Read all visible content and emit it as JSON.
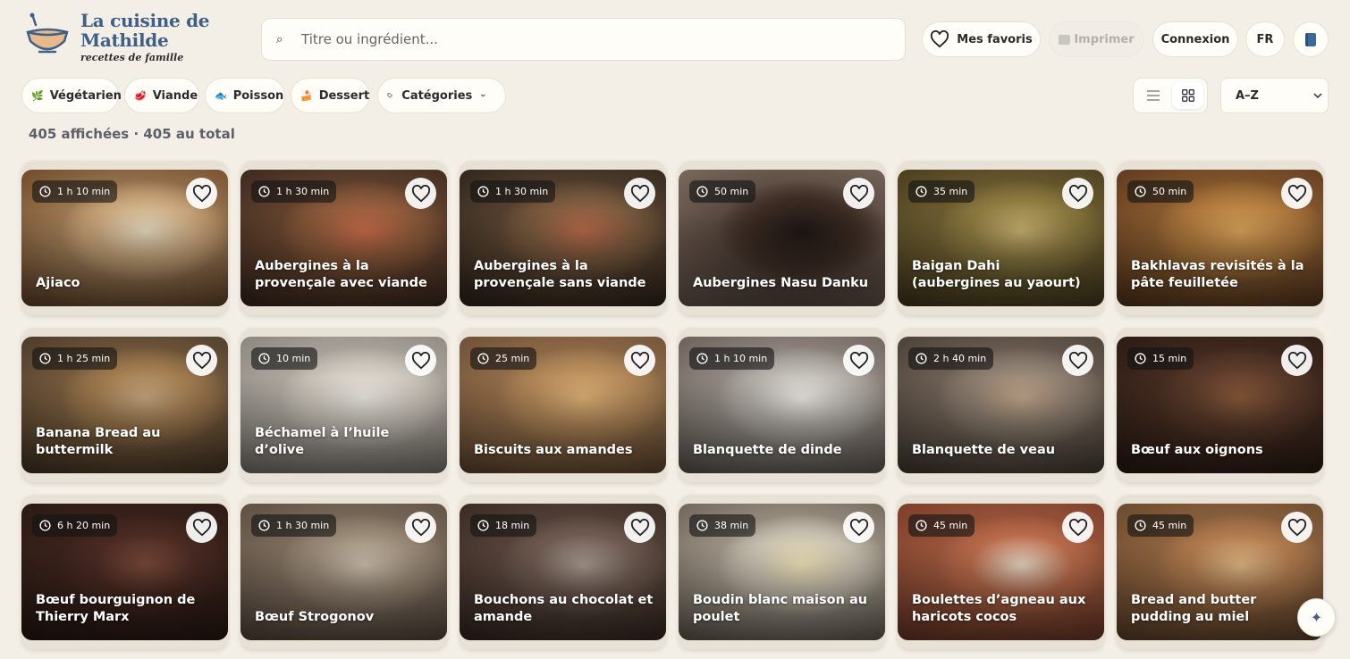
{
  "brand": {
    "title": "La cuisine de Mathilde",
    "subtitle": "recettes de famille"
  },
  "search": {
    "placeholder": "Titre ou ingrédient..."
  },
  "header_actions": {
    "favorites": "Mes favoris",
    "print": "Imprimer",
    "login": "Connexion",
    "language": "FR"
  },
  "filters": [
    {
      "label": "Végétarien",
      "icon": "leaf-icon"
    },
    {
      "label": "Viande",
      "icon": "meat-icon"
    },
    {
      "label": "Poisson",
      "icon": "fish-icon"
    },
    {
      "label": "Dessert",
      "icon": "cake-icon"
    }
  ],
  "categories_label": "Catégories",
  "sort": {
    "selected": "A–Z"
  },
  "count_text": "405 affichées · 405 au total",
  "colors": {
    "brand_blue": "#3e5f86",
    "background": "#f4efe6"
  },
  "recipes": [
    {
      "title": "Ajiaco",
      "time": "1 h 10 min"
    },
    {
      "title": "Aubergines à la provençale avec viande",
      "time": "1 h 30 min"
    },
    {
      "title": "Aubergines à la provençale sans viande",
      "time": "1 h 30 min"
    },
    {
      "title": "Aubergines Nasu Danku",
      "time": "50 min"
    },
    {
      "title": "Baigan Dahi (aubergines au yaourt)",
      "time": "35 min"
    },
    {
      "title": "Bakhlavas revisités à la pâte feuilletée",
      "time": "50 min"
    },
    {
      "title": "Banana Bread au buttermilk",
      "time": "1 h 25 min"
    },
    {
      "title": "Béchamel à l’huile d’olive",
      "time": "10 min"
    },
    {
      "title": "Biscuits aux amandes",
      "time": "25 min"
    },
    {
      "title": "Blanquette de dinde",
      "time": "1 h 10 min"
    },
    {
      "title": "Blanquette de veau",
      "time": "2 h 40 min"
    },
    {
      "title": "Bœuf aux oignons",
      "time": "15 min"
    },
    {
      "title": "Bœuf bourguignon de Thierry Marx",
      "time": "6 h 20 min"
    },
    {
      "title": "Bœuf Strogonov",
      "time": "1 h 30 min"
    },
    {
      "title": "Bouchons au chocolat et amande",
      "time": "18 min"
    },
    {
      "title": "Boudin blanc maison au poulet",
      "time": "38 min"
    },
    {
      "title": "Boulettes d’agneau aux haricots cocos",
      "time": "45 min"
    },
    {
      "title": "Bread and butter pudding au miel",
      "time": "45 min"
    }
  ]
}
